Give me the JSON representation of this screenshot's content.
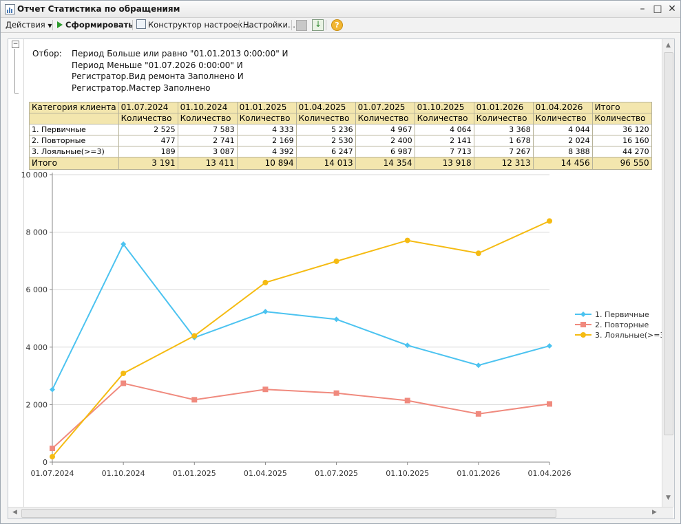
{
  "window": {
    "title": "Отчет  Статистика по обращениям"
  },
  "toolbar": {
    "actions_label": "Действия",
    "generate_label": "Сформировать",
    "constructor_label": "Конструктор настроек...",
    "settings_label": "Настройки..."
  },
  "filter": {
    "label": "Отбор:",
    "lines": [
      "Период Больше или равно \"01.01.2013 0:00:00\" И",
      "Период Меньше \"01.07.2026 0:00:00\" И",
      "Регистратор.Вид ремонта Заполнено И",
      "Регистратор.Мастер Заполнено"
    ]
  },
  "table": {
    "category_header": "Категория клиента",
    "periods": [
      "01.07.2024",
      "01.10.2024",
      "01.01.2025",
      "01.04.2025",
      "01.07.2025",
      "01.10.2025",
      "01.01.2026",
      "01.04.2026"
    ],
    "total_header": "Итого",
    "measure": "Количество",
    "rows": [
      {
        "name": "1. Первичные",
        "values": [
          "2 525",
          "7 583",
          "4 333",
          "5 236",
          "4 967",
          "4 064",
          "3 368",
          "4 044"
        ],
        "total": "36 120"
      },
      {
        "name": "2. Повторные",
        "values": [
          "477",
          "2 741",
          "2 169",
          "2 530",
          "2 400",
          "2 141",
          "1 678",
          "2 024"
        ],
        "total": "16 160"
      },
      {
        "name": "3. Лояльные(>=3)",
        "values": [
          "189",
          "3 087",
          "4 392",
          "6 247",
          "6 987",
          "7 713",
          "7 267",
          "8 388"
        ],
        "total": "44 270"
      }
    ],
    "totals": {
      "label": "Итого",
      "values": [
        "3 191",
        "13 411",
        "10 894",
        "14 013",
        "14 354",
        "13 918",
        "12 313",
        "14 456"
      ],
      "grand": "96 550"
    }
  },
  "chart_data": {
    "type": "line",
    "categories": [
      "01.07.2024",
      "01.10.2024",
      "01.01.2025",
      "01.04.2025",
      "01.07.2025",
      "01.10.2025",
      "01.01.2026",
      "01.04.2026"
    ],
    "ylim": [
      0,
      10000
    ],
    "yticks": [
      "0",
      "2 000",
      "4 000",
      "6 000",
      "8 000",
      "10 000"
    ],
    "grid": true,
    "legend_position": "right",
    "series": [
      {
        "name": "1. Первичные",
        "color": "#4cc3f0",
        "marker": "diamond",
        "values": [
          2525,
          7583,
          4333,
          5236,
          4967,
          4064,
          3368,
          4044
        ]
      },
      {
        "name": "2. Повторные",
        "color": "#f08a7e",
        "marker": "square",
        "values": [
          477,
          2741,
          2169,
          2530,
          2400,
          2141,
          1678,
          2024
        ]
      },
      {
        "name": "3. Лояльные(>=3)",
        "color": "#f5bb12",
        "marker": "circle",
        "values": [
          189,
          3087,
          4392,
          6247,
          6987,
          7713,
          7267,
          8388
        ]
      }
    ]
  }
}
